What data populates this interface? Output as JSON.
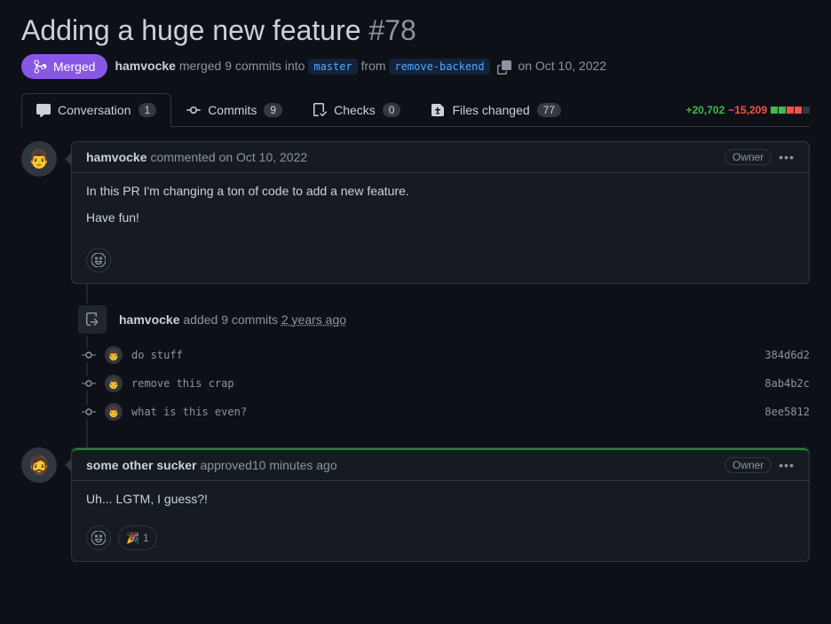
{
  "pr": {
    "title": "Adding a huge new feature",
    "number": "#78",
    "status": "Merged",
    "author": "hamvocke",
    "merge_text_1": "merged 9 commits into",
    "target_branch": "master",
    "from_text": "from",
    "source_branch": "remove-backend",
    "merge_text_2": "on Oct 10, 2022"
  },
  "tabs": {
    "conversation": {
      "label": "Conversation",
      "count": "1"
    },
    "commits": {
      "label": "Commits",
      "count": "9"
    },
    "checks": {
      "label": "Checks",
      "count": "0"
    },
    "files": {
      "label": "Files changed",
      "count": "77"
    }
  },
  "diff": {
    "additions": "+20,702",
    "deletions": "−15,209"
  },
  "comment1": {
    "author": "hamvocke",
    "action": "commented",
    "time": "on Oct 10, 2022",
    "badge": "Owner",
    "body_p1": "In this PR I'm changing a ton of code to add a new feature.",
    "body_p2": "Have fun!"
  },
  "commits_event": {
    "author": "hamvocke",
    "text": "added 9 commits",
    "time": "2 years ago"
  },
  "commits": [
    {
      "msg": "do stuff",
      "sha": "384d6d2"
    },
    {
      "msg": "remove this crap",
      "sha": "8ab4b2c"
    },
    {
      "msg": "what is this even?",
      "sha": "8ee5812"
    }
  ],
  "review": {
    "author": "some other sucker",
    "action": "approved",
    "time": "10 minutes ago",
    "badge": "Owner",
    "body": "Uh... LGTM, I guess?!",
    "reaction_emoji": "🎉",
    "reaction_count": "1"
  }
}
